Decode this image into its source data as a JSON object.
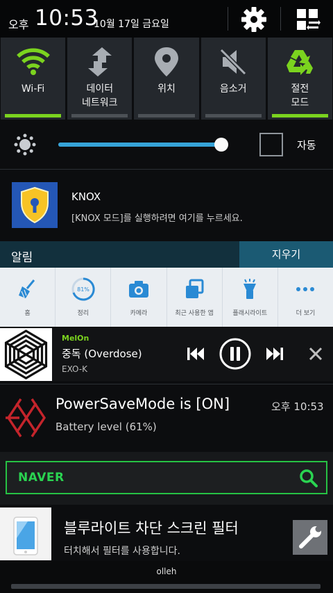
{
  "status_bar": {
    "ampm": "오후",
    "time": "10:53",
    "date": "10월 17일 금요일",
    "settings_icon": "gear-icon",
    "edit_icon": "grid-edit-icon"
  },
  "quick_toggles": [
    {
      "label": "Wi-Fi",
      "state": "on",
      "icon": "wifi-icon"
    },
    {
      "label": "데이터\n네트워크",
      "state": "off",
      "icon": "data-arrows-icon"
    },
    {
      "label": "위치",
      "state": "off",
      "icon": "location-pin-icon"
    },
    {
      "label": "음소거",
      "state": "off",
      "icon": "mute-icon"
    },
    {
      "label": "절전\n모드",
      "state": "on",
      "icon": "recycle-icon"
    }
  ],
  "brightness": {
    "level": 0.98,
    "auto_label": "자동",
    "auto_checked": false
  },
  "knox": {
    "title": "KNOX",
    "description": "[KNOX 모드]를 실행하려면 여기를 누르세요."
  },
  "alerts": {
    "title": "알림",
    "clear_label": "지우기"
  },
  "shortcuts": [
    {
      "label": "홈",
      "icon": "broom-icon"
    },
    {
      "label": "정리",
      "icon": "ram-gauge-icon",
      "gauge_text": "81%"
    },
    {
      "label": "카메라",
      "icon": "camera-icon"
    },
    {
      "label": "최근 사용한 앱",
      "icon": "recent-apps-icon"
    },
    {
      "label": "플래시라이트",
      "icon": "flashlight-icon"
    },
    {
      "label": "더 보기",
      "icon": "more-dots-icon"
    }
  ],
  "melon": {
    "app": "MelOn",
    "song": "중독 (Overdose)",
    "artist": "EXO-K"
  },
  "power_save": {
    "title": "PowerSaveMode is [ON]",
    "time": "오후 10:53",
    "description": "Battery level (61%)"
  },
  "naver": {
    "logo": "NAVER"
  },
  "blue_light": {
    "title": "블루라이트 차단 스크린 필터",
    "description": "터치해서 필터를 사용합니다."
  },
  "carrier": {
    "label": "olleh"
  },
  "colors": {
    "accent_green": "#7bd31f",
    "accent_blue": "#36a3d8",
    "naver_green": "#2ad351"
  }
}
